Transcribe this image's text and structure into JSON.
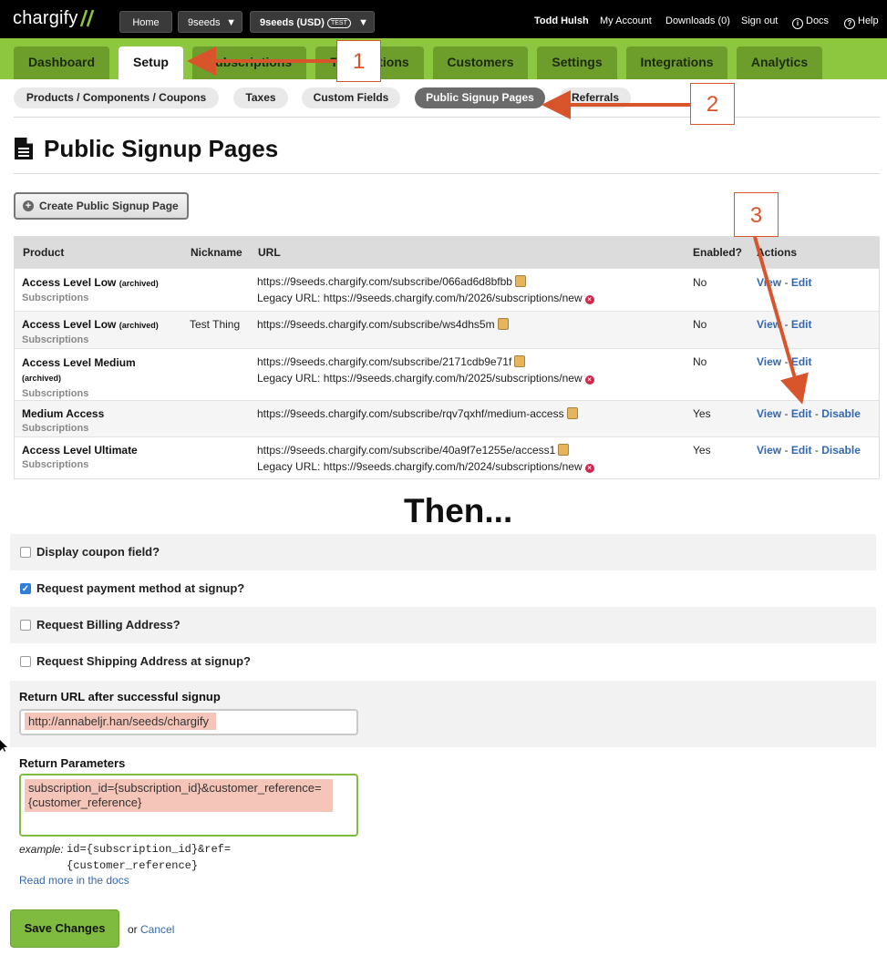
{
  "topbar": {
    "logo": "chargify",
    "home": "Home",
    "site": "9seeds",
    "account": "9seeds (USD)",
    "account_badge": "TEST",
    "user": "Todd Hulsh",
    "my_account": "My Account",
    "downloads": "Downloads (0)",
    "sign_out": "Sign out",
    "docs": "Docs",
    "help": "Help"
  },
  "nav": {
    "tabs": [
      "Dashboard",
      "Setup",
      "Subscriptions",
      "Transactions",
      "Customers",
      "Settings",
      "Integrations",
      "Analytics"
    ]
  },
  "subnav": {
    "items": [
      "Products / Components / Coupons",
      "Taxes",
      "Custom Fields",
      "Public Signup Pages",
      "Referrals"
    ]
  },
  "page": {
    "title": "Public Signup Pages",
    "create_button": "Create Public Signup Page"
  },
  "table": {
    "headers": {
      "product": "Product",
      "nickname": "Nickname",
      "url": "URL",
      "enabled": "Enabled?",
      "actions": "Actions"
    },
    "rows": [
      {
        "name": "Access Level Low",
        "archived": "(archived)",
        "family": "Subscriptions",
        "nickname": "",
        "url": "https://9seeds.chargify.com/subscribe/066ad6d8bfbb",
        "legacy": "Legacy URL: https://9seeds.chargify.com/h/2026/subscriptions/new",
        "enabled": "No",
        "view": "View",
        "edit": "Edit",
        "disable": ""
      },
      {
        "name": "Access Level Low",
        "archived": "(archived)",
        "family": "Subscriptions",
        "nickname": "Test Thing",
        "url": "https://9seeds.chargify.com/subscribe/ws4dhs5m",
        "legacy": "",
        "enabled": "No",
        "view": "View",
        "edit": "Edit",
        "disable": ""
      },
      {
        "name": "Access Level Medium",
        "archived": "(archived)",
        "family": "Subscriptions",
        "nickname": "",
        "url": "https://9seeds.chargify.com/subscribe/2171cdb9e71f",
        "legacy": "Legacy URL: https://9seeds.chargify.com/h/2025/subscriptions/new",
        "enabled": "No",
        "view": "View",
        "edit": "Edit",
        "disable": ""
      },
      {
        "name": "Medium Access",
        "archived": "",
        "family": "Subscriptions",
        "nickname": "",
        "url": "https://9seeds.chargify.com/subscribe/rqv7qxhf/medium-access",
        "legacy": "",
        "enabled": "Yes",
        "view": "View",
        "edit": "Edit",
        "disable": "Disable"
      },
      {
        "name": "Access Level Ultimate",
        "archived": "",
        "family": "Subscriptions",
        "nickname": "",
        "url": "https://9seeds.chargify.com/subscribe/40a9f7e1255e/access1",
        "legacy": "Legacy URL: https://9seeds.chargify.com/h/2024/subscriptions/new",
        "enabled": "Yes",
        "view": "View",
        "edit": "Edit",
        "disable": "Disable"
      }
    ]
  },
  "then_text": "Then...",
  "form": {
    "coupon": {
      "label": "Display coupon field?",
      "checked": false
    },
    "payment": {
      "label": "Request payment method at signup?",
      "checked": true
    },
    "billing": {
      "label": "Request Billing Address?",
      "checked": false
    },
    "shipping": {
      "label": "Request Shipping Address at signup?",
      "checked": false
    },
    "return_url_label": "Return URL after successful signup",
    "return_url_value": "http://annabeljr.han/seeds/chargify",
    "return_params_label": "Return Parameters",
    "return_params_value": "subscription_id={subscription_id}&customer_reference={customer_reference}",
    "example_label": "example:",
    "example_code": "id={subscription_id}&ref={customer_reference}",
    "docs_link": "Read more in the docs",
    "save": "Save Changes",
    "or": "or",
    "cancel": "Cancel"
  },
  "annotations": [
    "1",
    "2",
    "3"
  ],
  "colors": {
    "nav_green": "#8dc63f",
    "arrow": "#d8552b",
    "link": "#3467b1"
  }
}
